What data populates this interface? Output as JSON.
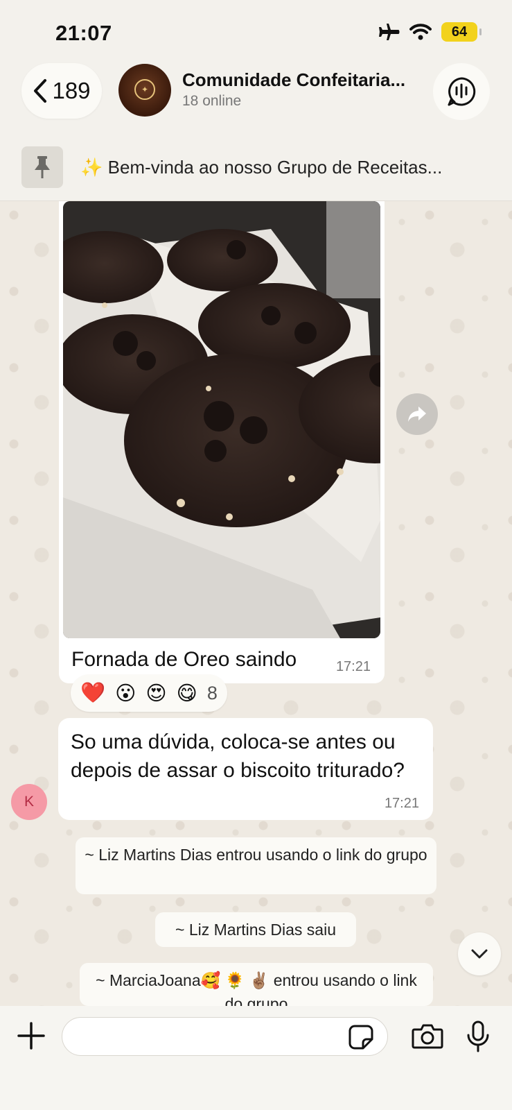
{
  "status_bar": {
    "time": "21:07",
    "battery": "64"
  },
  "header": {
    "back_count": "189",
    "group_name": "Comunidade Confeitaria...",
    "subtitle": "18 online"
  },
  "pinned": {
    "text": "✨ Bem-vinda ao nosso Grupo de Receitas..."
  },
  "image_message": {
    "caption": "Fornada de Oreo saindo",
    "time": "17:21",
    "reactions": [
      "❤️",
      "😮",
      "😍",
      "😋"
    ],
    "reaction_count": "8"
  },
  "text_message": {
    "sender_initial": "K",
    "text": "So uma dúvida, coloca-se antes ou depois de assar o biscoito triturado?",
    "time": "17:21"
  },
  "system_messages": [
    "~ Liz Martins Dias entrou usando o link do grupo",
    "~ Liz Martins Dias saiu",
    "~ MarciaJoana🥰 🌻 ✌🏽 entrou usando o link do grupo"
  ],
  "input": {
    "placeholder": ""
  },
  "colors": {
    "battery": "#f2d21c",
    "sender_avatar": "#f59aa6",
    "wallpaper": "#efeae2"
  }
}
